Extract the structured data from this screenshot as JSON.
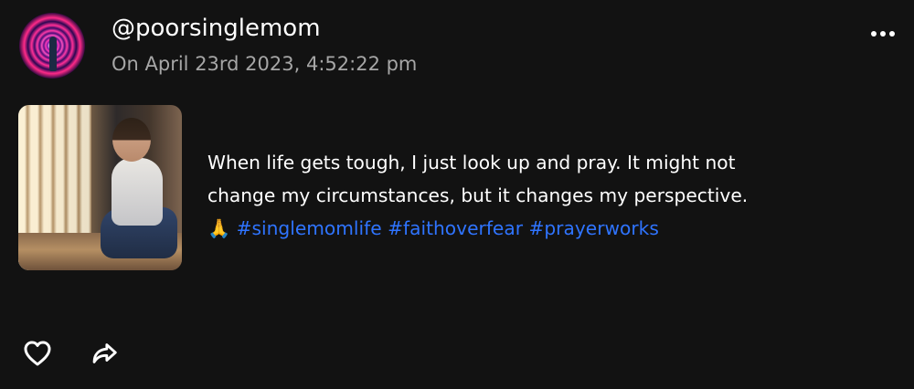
{
  "post": {
    "username": "@poorsinglemom",
    "timestamp": "On April 23rd 2023, 4:52:22 pm",
    "text": {
      "line1": "When life gets tough, I just look up and pray. It might not",
      "line2": "change my circumstances, but it changes my perspective.",
      "emoji": "🙏",
      "hashtags": [
        "#singlemomlife",
        "#faithoverfear",
        "#prayerworks"
      ]
    },
    "icons": {
      "more": "more-options-icon",
      "like": "heart-icon",
      "share": "share-arrow-icon"
    }
  },
  "colors": {
    "background": "#121212",
    "hashtag": "#2f74ff",
    "secondary_text": "#a6a6a6"
  }
}
